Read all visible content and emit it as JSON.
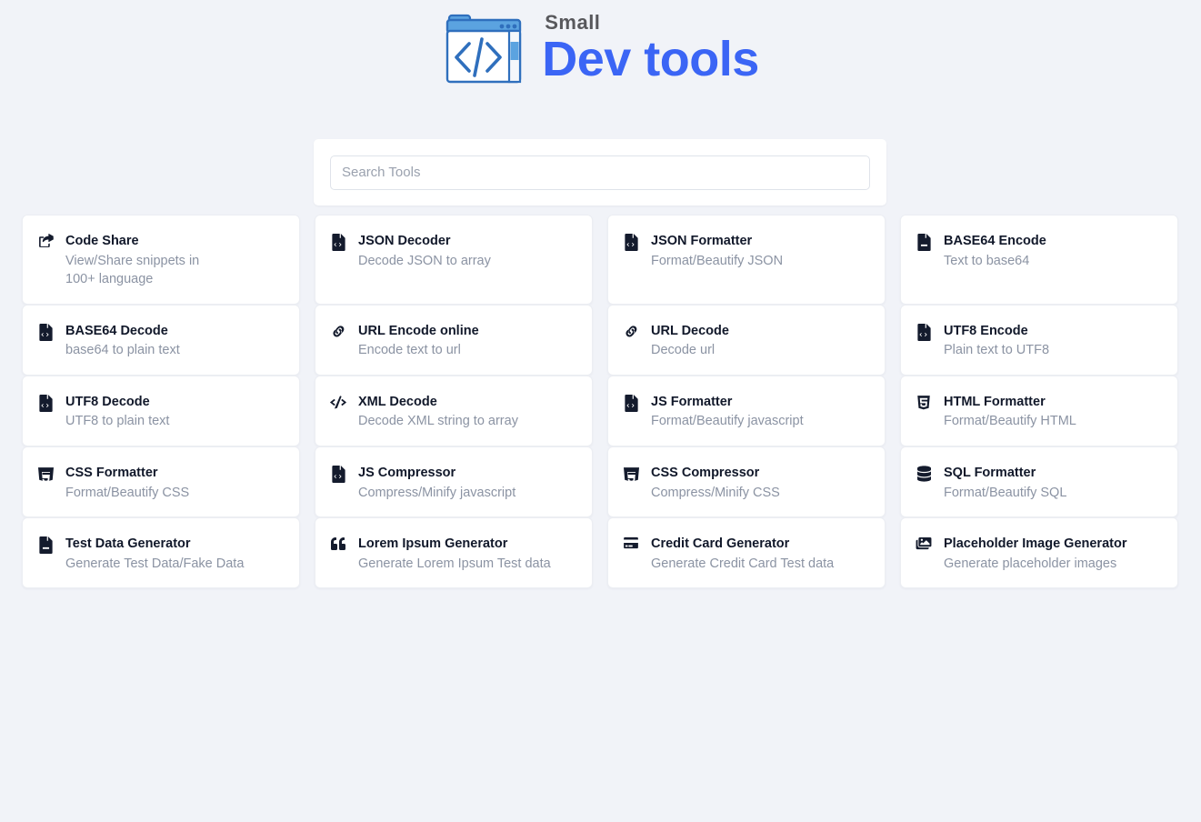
{
  "brand": {
    "small_text": "Small",
    "main_text": "Dev tools",
    "accent_color": "#3b65f5",
    "logo_icon": "code-window-folder-icon"
  },
  "search": {
    "placeholder": "Search Tools",
    "value": ""
  },
  "theme": {
    "background": "#f1f3f8",
    "card_background": "#ffffff",
    "title_color": "#11182a",
    "description_color": "#8b93a3"
  },
  "tool_rows": [
    [
      {
        "title": "Code Share",
        "desc": "View/Share snippets in 100+ language",
        "icon": "share-square-icon",
        "wrap": true
      },
      {
        "title": "JSON Decoder",
        "desc": "Decode JSON to array",
        "icon": "file-code-icon",
        "wrap": false
      },
      {
        "title": "JSON Formatter",
        "desc": "Format/Beautify JSON",
        "icon": "file-code-icon",
        "wrap": false
      },
      {
        "title": "BASE64 Encode",
        "desc": "Text to base64",
        "icon": "file-alt-icon",
        "wrap": false
      }
    ],
    [
      {
        "title": "BASE64 Decode",
        "desc": "base64 to plain text",
        "icon": "file-code-icon",
        "wrap": false
      },
      {
        "title": "URL Encode online",
        "desc": "Encode text to url",
        "icon": "link-icon",
        "wrap": false
      },
      {
        "title": "URL Decode",
        "desc": "Decode url",
        "icon": "link-icon",
        "wrap": false
      },
      {
        "title": "UTF8 Encode",
        "desc": "Plain text to UTF8",
        "icon": "file-code-icon",
        "wrap": false
      }
    ],
    [
      {
        "title": "UTF8 Decode",
        "desc": "UTF8 to plain text",
        "icon": "file-code-icon",
        "wrap": false
      },
      {
        "title": "XML Decode",
        "desc": "Decode XML string to array",
        "icon": "code-brackets-icon",
        "wrap": false
      },
      {
        "title": "JS Formatter",
        "desc": "Format/Beautify javascript",
        "icon": "file-code-icon",
        "wrap": false
      },
      {
        "title": "HTML Formatter",
        "desc": "Format/Beautify HTML",
        "icon": "html5-icon",
        "wrap": false
      }
    ],
    [
      {
        "title": "CSS Formatter",
        "desc": "Format/Beautify CSS",
        "icon": "css3-icon",
        "wrap": false
      },
      {
        "title": "JS Compressor",
        "desc": "Compress/Minify javascript",
        "icon": "file-code-icon",
        "wrap": false
      },
      {
        "title": "CSS Compressor",
        "desc": "Compress/Minify CSS",
        "icon": "css3-icon",
        "wrap": false
      },
      {
        "title": "SQL Formatter",
        "desc": "Format/Beautify SQL",
        "icon": "database-icon",
        "wrap": false
      }
    ],
    [
      {
        "title": "Test Data Generator",
        "desc": "Generate Test Data/Fake Data",
        "icon": "file-alt-icon",
        "wrap": false
      },
      {
        "title": "Lorem Ipsum Generator",
        "desc": "Generate Lorem Ipsum Test data",
        "icon": "quote-left-icon",
        "wrap": false
      },
      {
        "title": "Credit Card Generator",
        "desc": "Generate Credit Card Test data",
        "icon": "credit-card-icon",
        "wrap": false
      },
      {
        "title": "Placeholder Image Generator",
        "desc": "Generate placeholder images",
        "icon": "images-icon",
        "wrap": false
      }
    ]
  ]
}
